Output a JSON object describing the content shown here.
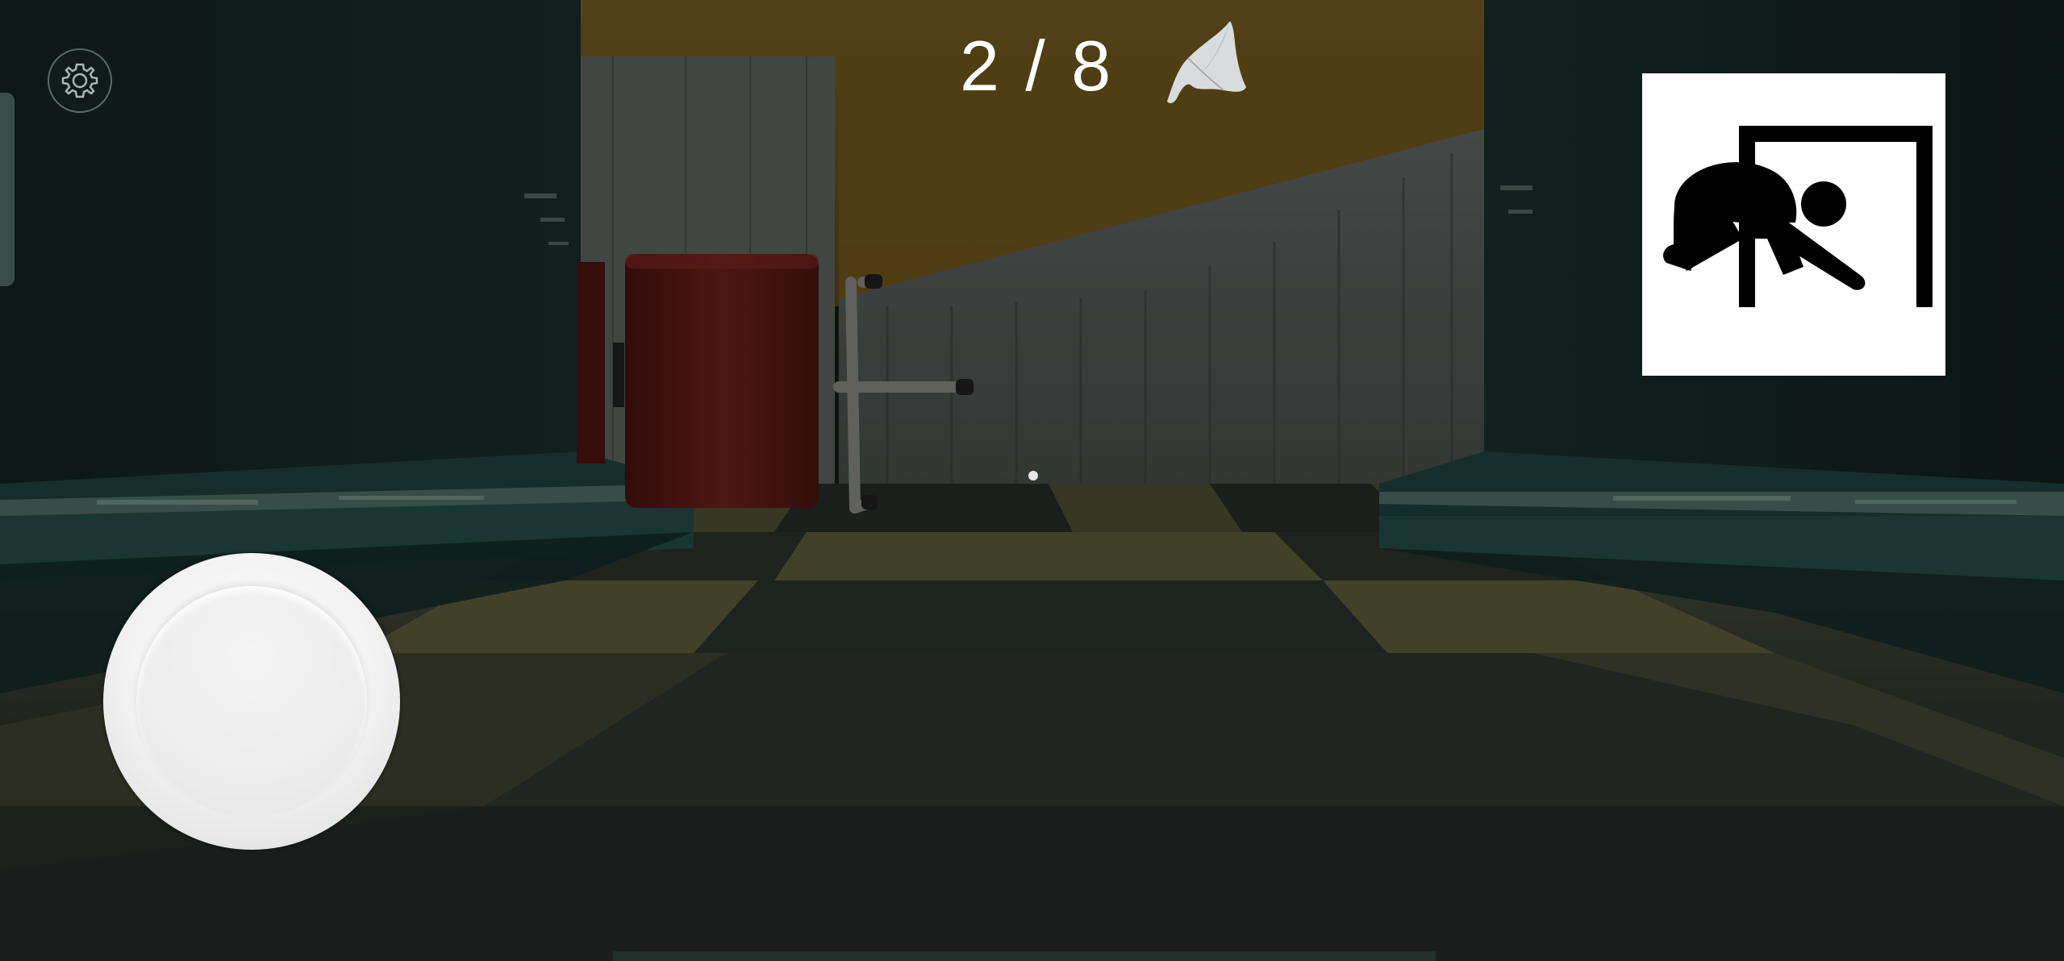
{
  "hud": {
    "collected": 2,
    "total": 8,
    "counter_text": "2 / 8",
    "collectible_icon": "cloth-icon",
    "settings_icon": "gear-icon",
    "crouch_icon": "crouch-icon",
    "joystick_icon": "joystick"
  },
  "colors": {
    "wall": "#0f1e1c",
    "floor_light": "#4a4a2e",
    "floor_dark": "#1c2220",
    "ceiling": "#5a4418",
    "cabinet": "#4a1210",
    "hud_text": "#ffffff"
  }
}
